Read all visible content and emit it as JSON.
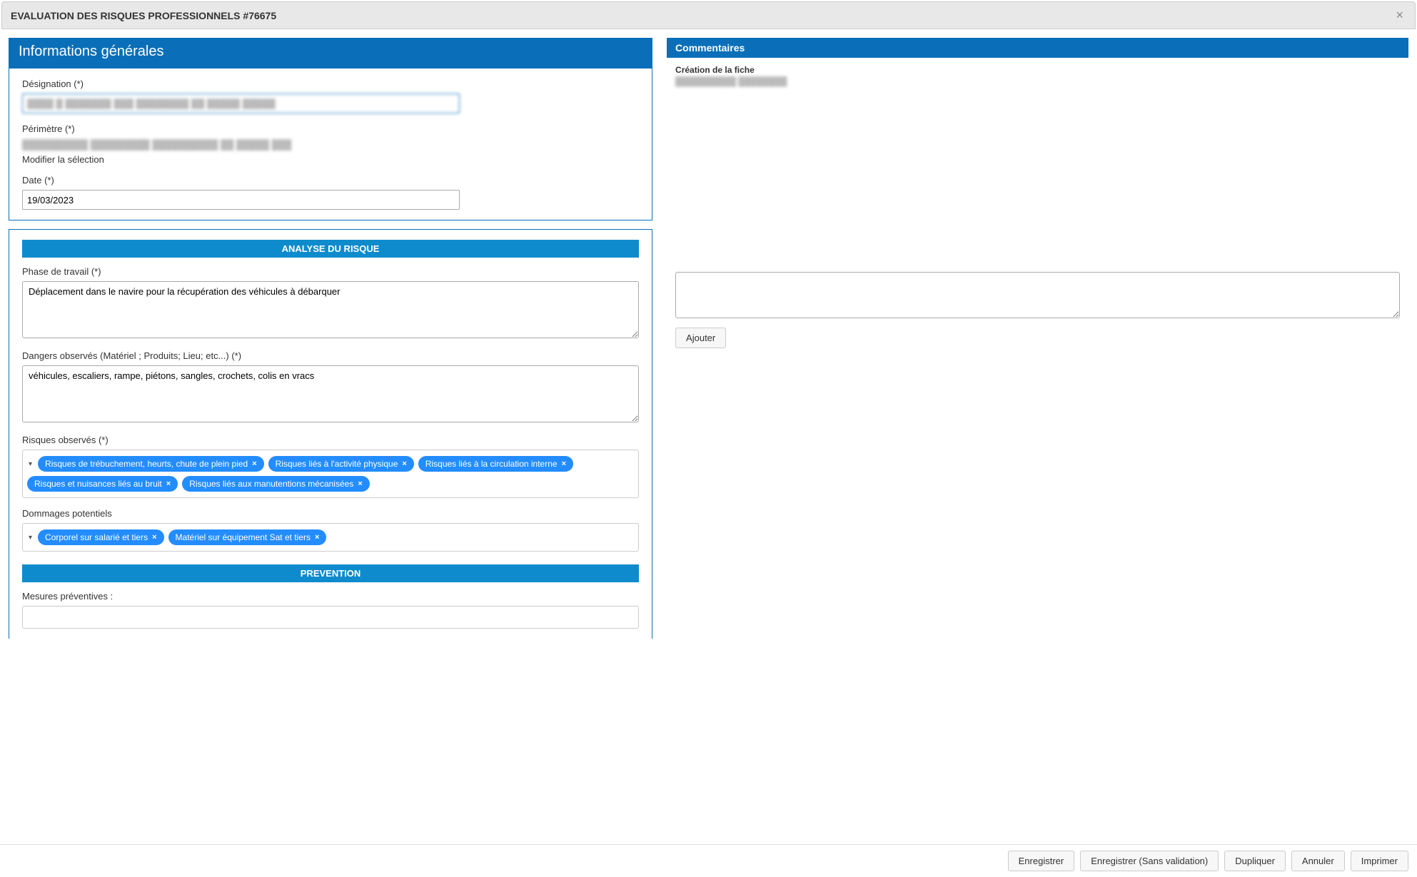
{
  "titlebar": {
    "title": "EVALUATION DES RISQUES PROFESSIONNELS #76675"
  },
  "general": {
    "header": "Informations générales",
    "designation_label": "Désignation (*)",
    "designation_value": "████ █ ███████ ███ ████████ ██ █████ █████",
    "perimetre_label": "Périmètre (*)",
    "perimetre_value": "██████████ █████████ ██████████ ██ █████ ███",
    "modifier_label": "Modifier la sélection",
    "date_label": "Date (*)",
    "date_value": "19/03/2023"
  },
  "analysis": {
    "section_title": "ANALYSE DU RISQUE",
    "phase_label": "Phase de travail (*)",
    "phase_value": "Déplacement dans le navire pour la récupération des véhicules à débarquer",
    "dangers_label": "Dangers observés (Matériel ; Produits; Lieu; etc...) (*)",
    "dangers_value": "véhicules, escaliers, rampe, piétons, sangles, crochets, colis en vracs",
    "risques_label": "Risques observés (*)",
    "risques_tags": [
      "Risques de trébuchement, heurts, chute de plein pied",
      "Risques liés à l'activité physique",
      "Risques liés à la circulation interne",
      "Risques et nuisances liés au bruit",
      "Risques liés aux manutentions mécanisées"
    ],
    "dommages_label": "Dommages potentiels",
    "dommages_tags": [
      "Corporel sur salarié et tiers",
      "Matériel sur équipement Sat et tiers"
    ]
  },
  "prevention": {
    "section_title": "PREVENTION",
    "mesures_label": "Mesures préventives :"
  },
  "comments": {
    "header": "Commentaires",
    "creation_label": "Création de la fiche",
    "creation_meta": "██████████ ████████",
    "add_button": "Ajouter"
  },
  "footer": {
    "save": "Enregistrer",
    "save_no_valid": "Enregistrer (Sans validation)",
    "duplicate": "Dupliquer",
    "cancel": "Annuler",
    "print": "Imprimer"
  }
}
